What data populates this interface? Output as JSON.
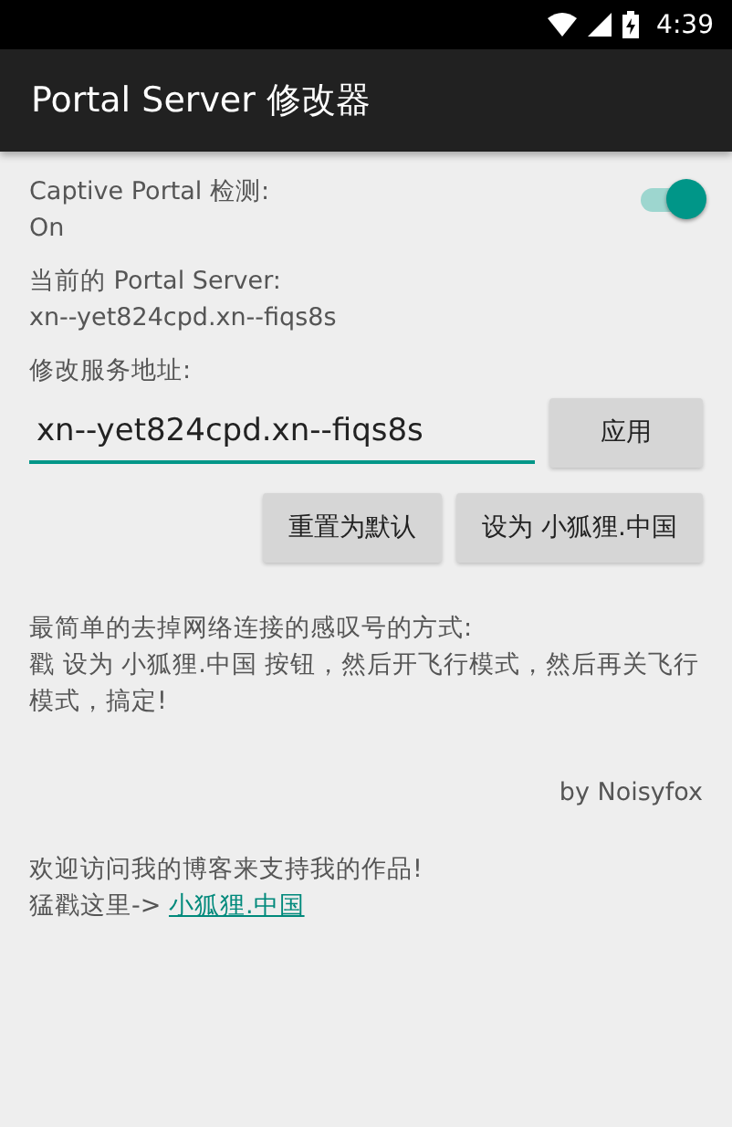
{
  "status_bar": {
    "time": "4:39"
  },
  "app_bar": {
    "title": "Portal Server 修改器"
  },
  "captive_portal": {
    "label": "Captive Portal 检测:",
    "state_text": "On",
    "on": true
  },
  "current_server": {
    "label": "当前的 Portal Server:",
    "value": "xn--yet824cpd.xn--fiqs8s"
  },
  "modify": {
    "label": "修改服务地址:",
    "value": "xn--yet824cpd.xn--fiqs8s",
    "apply_button": "应用"
  },
  "buttons": [
    "重置为默认",
    "设为 小狐狸.中国"
  ],
  "tip": {
    "heading": "最简单的去掉网络连接的感叹号的方式:",
    "body": "戳 设为 小狐狸.中国 按钮，然后开飞行模式，然后再关飞行模式，搞定!"
  },
  "author": "by Noisyfox",
  "blog": {
    "text": "欢迎访问我的博客来支持我的作品!",
    "prefix": "猛戳这里-> ",
    "link": "小狐狸.中国"
  }
}
